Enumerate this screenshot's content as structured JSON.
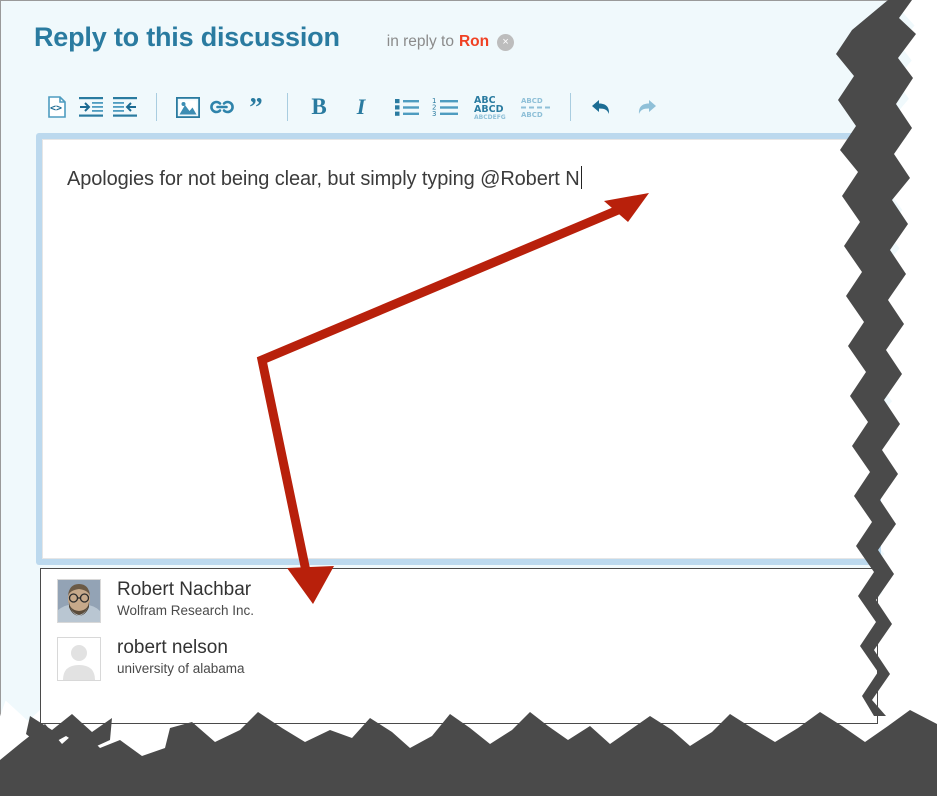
{
  "header": {
    "title": "Reply to this discussion",
    "in_reply_label": "in reply to",
    "in_reply_name": "Ron",
    "remove_icon": "×",
    "title_color": "#2a7ba0",
    "name_color": "#f04124"
  },
  "toolbar": {
    "groups": [
      {
        "buttons": [
          {
            "name": "source-code-icon",
            "label": "Source"
          },
          {
            "name": "indent-icon",
            "label": "Indent"
          },
          {
            "name": "outdent-icon",
            "label": "Outdent"
          }
        ]
      },
      {
        "buttons": [
          {
            "name": "image-icon",
            "label": "Insert Image"
          },
          {
            "name": "link-icon",
            "label": "Insert Link"
          },
          {
            "name": "quote-icon",
            "label": "Block Quote"
          }
        ]
      },
      {
        "buttons": [
          {
            "name": "bold-icon",
            "label": "B"
          },
          {
            "name": "italic-icon",
            "label": "I"
          },
          {
            "name": "bullet-list-icon",
            "label": "Bulleted List"
          },
          {
            "name": "numbered-list-icon",
            "label": "Numbered List"
          },
          {
            "name": "spellcheck-icon",
            "label": "Spell Check"
          },
          {
            "name": "text-replace-icon",
            "label": "Find and Replace"
          }
        ]
      },
      {
        "buttons": [
          {
            "name": "undo-icon",
            "label": "Undo"
          },
          {
            "name": "redo-icon",
            "label": "Redo"
          }
        ]
      }
    ],
    "icon_color": "#2a7ba0",
    "icon_color_muted": "#8fc0d8"
  },
  "editor": {
    "content": "Apologies for not being clear, but simply typing @Robert N",
    "caret_visible": true,
    "focus_ring_color": "#bcd9ee"
  },
  "mention_dropdown": {
    "visible": true,
    "items": [
      {
        "name": "Robert Nachbar",
        "organization": "Wolfram Research Inc.",
        "avatar": "photo-avatar"
      },
      {
        "name": "robert nelson",
        "organization": "university of alabama",
        "avatar": "placeholder-avatar"
      }
    ]
  },
  "annotation": {
    "arrow_color": "#b8200b",
    "description": "double-headed arrow from editor text to mention suggestion"
  }
}
